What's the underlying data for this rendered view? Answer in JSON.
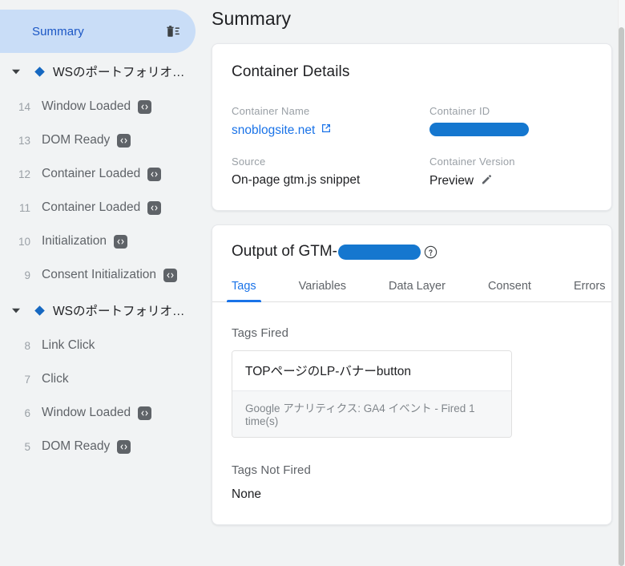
{
  "sidebar": {
    "summary": {
      "label": "Summary",
      "delete_icon": "trash-list-icon"
    },
    "groups": [
      {
        "type": "group",
        "caret_icon": "caret-down-icon",
        "marker_icon": "diamond-icon",
        "label": "WSのポートフォリオブ…"
      },
      {
        "type": "event",
        "num": "14",
        "label": "Window Loaded",
        "badge_icon": "code-icon",
        "has_badge": true
      },
      {
        "type": "event",
        "num": "13",
        "label": "DOM Ready",
        "badge_icon": "code-icon",
        "has_badge": true
      },
      {
        "type": "event",
        "num": "12",
        "label": "Container Loaded",
        "badge_icon": "code-icon",
        "has_badge": true
      },
      {
        "type": "event",
        "num": "11",
        "label": "Container Loaded",
        "badge_icon": "code-icon",
        "has_badge": true
      },
      {
        "type": "event",
        "num": "10",
        "label": "Initialization",
        "badge_icon": "code-icon",
        "has_badge": true
      },
      {
        "type": "event",
        "num": "9",
        "label": "Consent Initialization",
        "badge_icon": "code-icon",
        "has_badge": true
      },
      {
        "type": "group",
        "caret_icon": "caret-down-icon",
        "marker_icon": "diamond-icon",
        "label": "WSのポートフォリオブ…"
      },
      {
        "type": "event",
        "num": "8",
        "label": "Link Click",
        "has_badge": false
      },
      {
        "type": "event",
        "num": "7",
        "label": "Click",
        "has_badge": false
      },
      {
        "type": "event",
        "num": "6",
        "label": "Window Loaded",
        "badge_icon": "code-icon",
        "has_badge": true
      },
      {
        "type": "event",
        "num": "5",
        "label": "DOM Ready",
        "badge_icon": "code-icon",
        "has_badge": true
      }
    ]
  },
  "main": {
    "page_title": "Summary",
    "container_details": {
      "heading": "Container Details",
      "fields": {
        "container_name_label": "Container Name",
        "container_name_value": "snoblogsite.net",
        "container_name_external_icon": "external-link-icon",
        "container_id_label": "Container ID",
        "container_id_value": "",
        "container_id_redacted": true,
        "source_label": "Source",
        "source_value": "On-page gtm.js snippet",
        "container_version_label": "Container Version",
        "container_version_value": "Preview",
        "container_version_edit_icon": "pencil-icon"
      }
    },
    "output": {
      "title_prefix": "Output of GTM-",
      "title_redacted": true,
      "help_icon": "help-circle-icon",
      "tabs": [
        {
          "label": "Tags",
          "active": true
        },
        {
          "label": "Variables",
          "active": false
        },
        {
          "label": "Data Layer",
          "active": false
        },
        {
          "label": "Consent",
          "active": false
        },
        {
          "label": "Errors",
          "active": false
        }
      ],
      "tags_fired_label": "Tags Fired",
      "tags_fired": [
        {
          "name": "TOPページのLP-バナーbutton",
          "meta": "Google アナリティクス: GA4 イベント - Fired 1 time(s)"
        }
      ],
      "tags_not_fired_label": "Tags Not Fired",
      "tags_not_fired_value": "None"
    }
  },
  "colors": {
    "accent_blue": "#1a73e8",
    "pill_blue": "#c9ddf7",
    "redaction_blue": "#1577cf",
    "text_primary": "#202124",
    "text_secondary": "#5f6368",
    "text_muted": "#9aa0a6",
    "page_bg": "#f1f3f4",
    "card_bg": "#ffffff"
  },
  "scrollbar": {
    "name": "vertical-scrollbar"
  }
}
